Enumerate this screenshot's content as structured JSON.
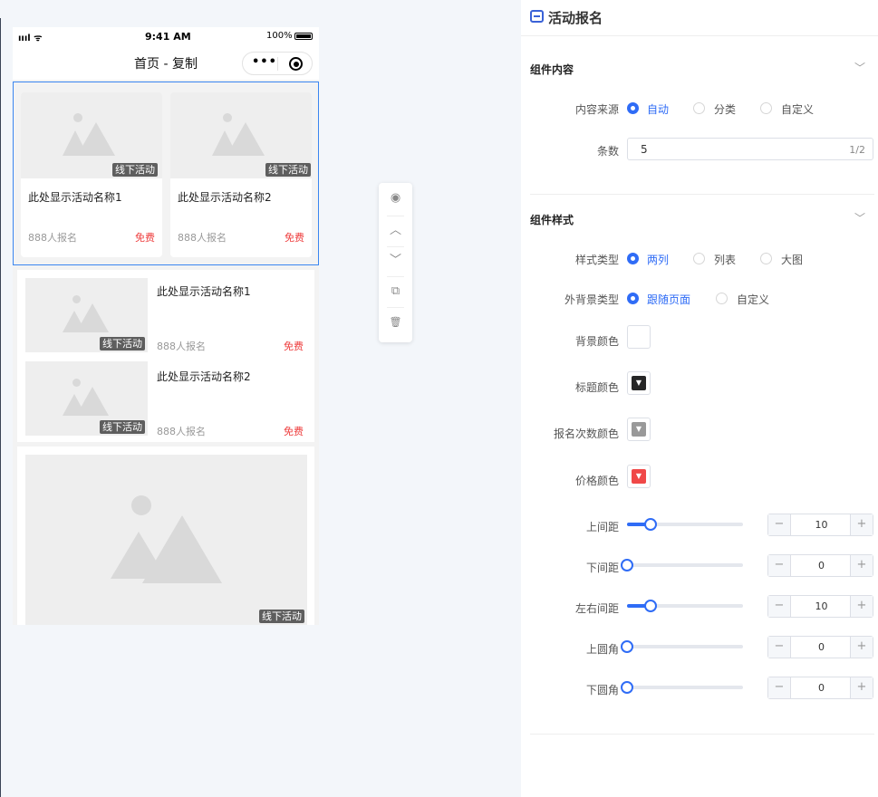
{
  "phone": {
    "status": {
      "signal": "ıııl ᯤ",
      "time": "9:41 AM",
      "battery": "100%"
    },
    "nav": {
      "title": "首页 - 复制",
      "menu_dots": "•••"
    },
    "module_grid": {
      "cards": [
        {
          "tag": "线下活动",
          "title": "此处显示活动名称1",
          "count": "888人报名",
          "price": "免费"
        },
        {
          "tag": "线下活动",
          "title": "此处显示活动名称2",
          "count": "888人报名",
          "price": "免费"
        }
      ]
    },
    "module_list": {
      "items": [
        {
          "tag": "线下活动",
          "title": "此处显示活动名称1",
          "count": "888人报名",
          "price": "免费"
        },
        {
          "tag": "线下活动",
          "title": "此处显示活动名称2",
          "count": "888人报名",
          "price": "免费"
        }
      ]
    },
    "module_big": {
      "tag": "线下活动"
    }
  },
  "toolbar": {
    "icons": [
      "eye-icon",
      "chevron-up-icon",
      "chevron-down-icon",
      "copy-icon",
      "trash-icon"
    ],
    "glyphs": {
      "eye": "◉",
      "up": "︿",
      "down": "﹀",
      "copy": "⧉",
      "trash": "🗑"
    }
  },
  "panel": {
    "title": "活动报名",
    "content_section": {
      "title": "组件内容",
      "source_label": "内容来源",
      "source_options": [
        "自动",
        "分类",
        "自定义"
      ],
      "source_selected": "自动",
      "count_label": "条数",
      "count_value": "5",
      "count_counter": "1/2"
    },
    "style_section": {
      "title": "组件样式",
      "style_type_label": "样式类型",
      "style_type_options": [
        "两列",
        "列表",
        "大图"
      ],
      "style_type_selected": "两列",
      "bg_type_label": "外背景类型",
      "bg_type_options": [
        "跟随页面",
        "自定义"
      ],
      "bg_type_selected": "跟随页面",
      "colors": [
        {
          "label": "背景颜色",
          "value": "#ffffff"
        },
        {
          "label": "标题颜色",
          "value": "#262626"
        },
        {
          "label": "报名次数颜色",
          "value": "#999999"
        },
        {
          "label": "价格颜色",
          "value": "#f04848"
        }
      ],
      "sliders": [
        {
          "label": "上间距",
          "value": "10",
          "fraction": 0.2
        },
        {
          "label": "下间距",
          "value": "0",
          "fraction": 0
        },
        {
          "label": "左右间距",
          "value": "10",
          "fraction": 0.2
        },
        {
          "label": "上圆角",
          "value": "0",
          "fraction": 0
        },
        {
          "label": "下圆角",
          "value": "0",
          "fraction": 0
        }
      ],
      "stepper_minus": "−",
      "stepper_plus": "+"
    },
    "collapse_chevron": "﹀"
  }
}
